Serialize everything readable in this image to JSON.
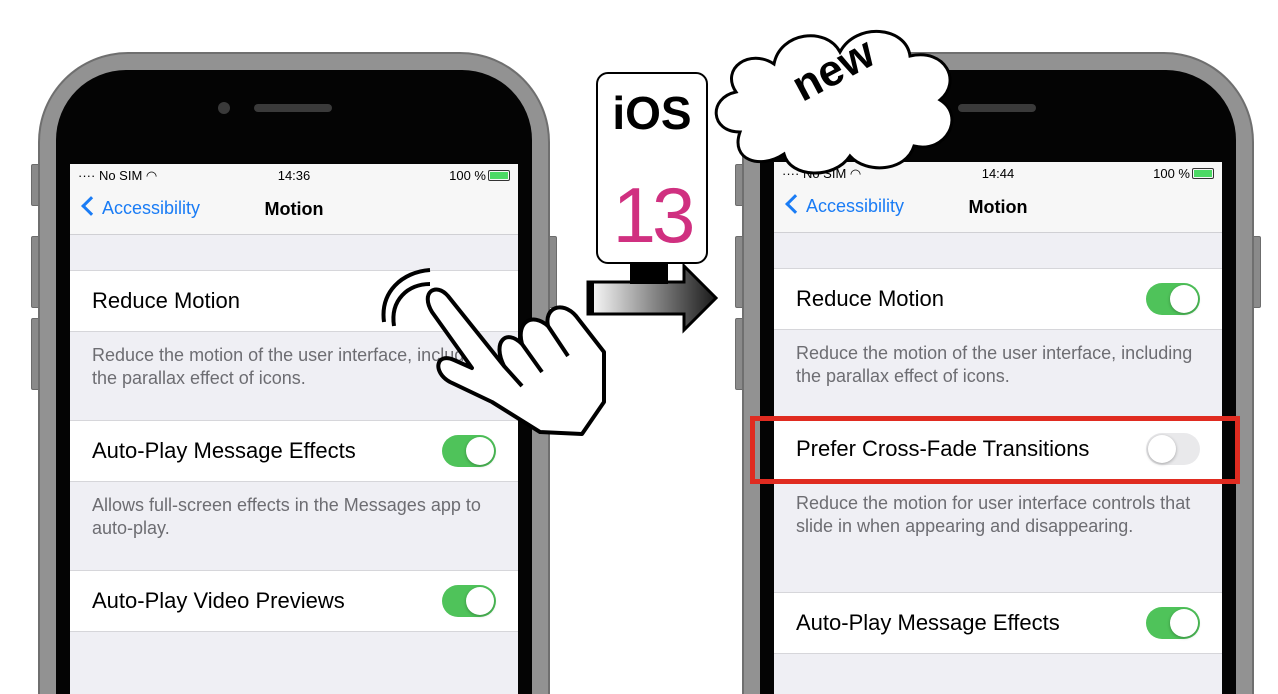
{
  "left_phone": {
    "status": {
      "carrier": "No SIM",
      "time": "14:36",
      "battery": "100 %"
    },
    "nav": {
      "back": "Accessibility",
      "title": "Motion"
    },
    "rows": [
      {
        "label": "Reduce Motion",
        "desc": "Reduce the motion of the user interface, including the parallax effect of icons."
      },
      {
        "label": "Auto-Play Message Effects",
        "on": true,
        "desc": "Allows full-screen effects in the Messages app to auto-play."
      },
      {
        "label": "Auto-Play Video Previews",
        "on": true
      }
    ]
  },
  "right_phone": {
    "status": {
      "carrier": "No SIM",
      "time": "14:44",
      "battery": "100 %"
    },
    "nav": {
      "back": "Accessibility",
      "title": "Motion"
    },
    "rows": [
      {
        "label": "Reduce Motion",
        "on": true,
        "desc": "Reduce the motion of the user interface, including the parallax effect of icons."
      },
      {
        "label": "Prefer Cross-Fade Transitions",
        "on": false,
        "desc": "Reduce the motion for user interface controls that slide in when appearing and disappearing."
      },
      {
        "label": "Auto-Play Message Effects",
        "on": true
      }
    ]
  },
  "badge": {
    "ios": "iOS",
    "version": "13",
    "cloud": "new"
  },
  "colors": {
    "toggle_on": "#4fc35a",
    "link": "#1a7cf5",
    "highlight": "#e02b20"
  }
}
